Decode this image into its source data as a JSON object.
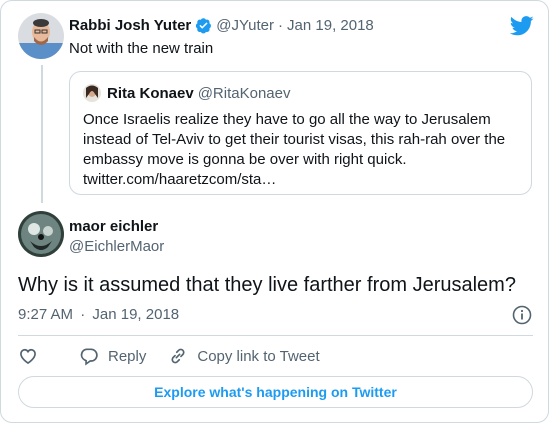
{
  "parent_tweet": {
    "name": "Rabbi Josh Yuter",
    "handle": "@JYuter",
    "separator": "·",
    "date": "Jan 19, 2018",
    "text": "Not with the new train"
  },
  "quoted_tweet": {
    "name": "Rita Konaev",
    "handle": "@RitaKonaev",
    "text": "Once Israelis realize they have to go all the way to Jerusalem instead of Tel-Aviv to get their tourist visas, this rah-rah over the embassy move is gonna be over with right quick. twitter.com/haaretzcom/sta…"
  },
  "main_tweet": {
    "name": "maor eichler",
    "handle": "@EichlerMaor",
    "text": "Why is it assumed that they live farther from Jerusalem?",
    "time": "9:27 AM",
    "separator": "·",
    "date": "Jan 19, 2018"
  },
  "actions": {
    "like_icon": "heart-icon",
    "reply_label": "Reply",
    "copy_link_label": "Copy link to Tweet"
  },
  "explore_button_label": "Explore what's happening on Twitter",
  "colors": {
    "accent": "#1d9bf0",
    "text": "#0f1419",
    "muted": "#536471",
    "border": "#cfd9de"
  }
}
